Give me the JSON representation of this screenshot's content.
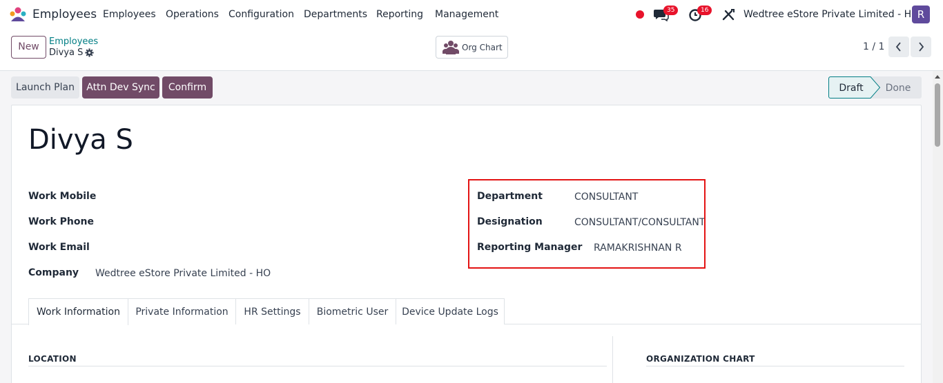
{
  "navbar": {
    "app_name": "Employees",
    "menu": [
      "Employees",
      "Operations",
      "Configuration",
      "Departments",
      "Reporting",
      "Management"
    ],
    "messages_count": "35",
    "activities_count": "16",
    "company": "Wedtree eStore Private Limited - HO",
    "avatar_letter": "R"
  },
  "control_panel": {
    "new_label": "New",
    "breadcrumb_parent": "Employees",
    "breadcrumb_current": "Divya S",
    "org_chart_label": "Org Chart",
    "pager": "1 / 1"
  },
  "actions": {
    "launch_plan": "Launch Plan",
    "attn_dev_sync": "Attn Dev Sync",
    "confirm": "Confirm"
  },
  "status": {
    "stages": [
      "Draft",
      "Done"
    ],
    "current": "Draft"
  },
  "employee": {
    "name": "Divya S",
    "left_fields": [
      {
        "label": "Work Mobile",
        "value": ""
      },
      {
        "label": "Work Phone",
        "value": ""
      },
      {
        "label": "Work Email",
        "value": ""
      },
      {
        "label": "Company",
        "value": "Wedtree eStore Private Limited - HO"
      }
    ],
    "right_fields": [
      {
        "label": "Department",
        "value": "CONSULTANT"
      },
      {
        "label": "Designation",
        "value": "CONSULTANT/CONSULTANT"
      },
      {
        "label": "Reporting Manager",
        "value": "RAMAKRISHNAN R"
      }
    ]
  },
  "tabs": [
    "Work Information",
    "Private Information",
    "HR Settings",
    "Biometric User",
    "Device Update Logs"
  ],
  "active_tab": "Work Information",
  "sections": {
    "location": "LOCATION",
    "org_chart": "ORGANIZATION CHART"
  },
  "colors": {
    "primary": "#714b67",
    "link": "#017e84",
    "badge": "#e8132b",
    "highlight": "#e31212"
  }
}
